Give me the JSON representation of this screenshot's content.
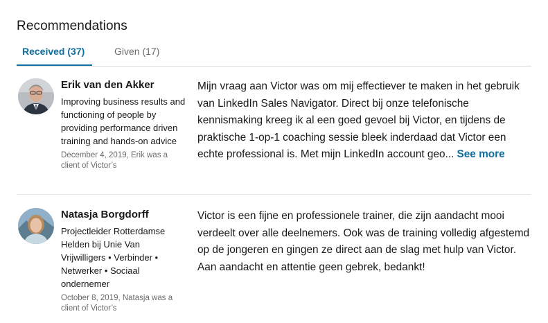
{
  "section": {
    "title": "Recommendations"
  },
  "tabs": [
    {
      "label": "Received (37)",
      "selected": true
    },
    {
      "label": "Given (17)",
      "selected": false
    }
  ],
  "recommendations": [
    {
      "name": "Erik van den Akker",
      "headline": "Improving business results and functioning of people by providing performance driven training and hands-on advice",
      "date": "December 4, 2019, Erik was a client of Victor’s",
      "text": "Mijn vraag aan Victor was om mij effectiever te maken in het gebruik van LinkedIn Sales Navigator. Direct bij onze telefonische kennismaking kreeg ik al een goed gevoel bij Victor, en tijdens de praktische 1-op-1 coaching sessie bleek inderdaad dat Victor een echte professional is. Met mijn LinkedIn account geo...",
      "see_more": "See more"
    },
    {
      "name": "Natasja Borgdorff",
      "headline": "Projectleider Rotterdamse Helden bij Unie Van Vrijwilligers • Verbinder • Netwerker • Sociaal ondernemer",
      "date": "October 8, 2019, Natasja was a client of Victor’s",
      "text": "Victor is een fijne en professionele trainer, die zijn aandacht mooi verdeelt over alle deelnemers. Ook was de training volledig afgestemd op de jongeren en gingen ze direct aan de slag met hulp van Victor. Aan aandacht en attentie geen gebrek, bedankt!"
    }
  ],
  "colors": {
    "accent": "#0f6e9e",
    "muted_text": "#666666",
    "divider": "#dcdcdc"
  }
}
